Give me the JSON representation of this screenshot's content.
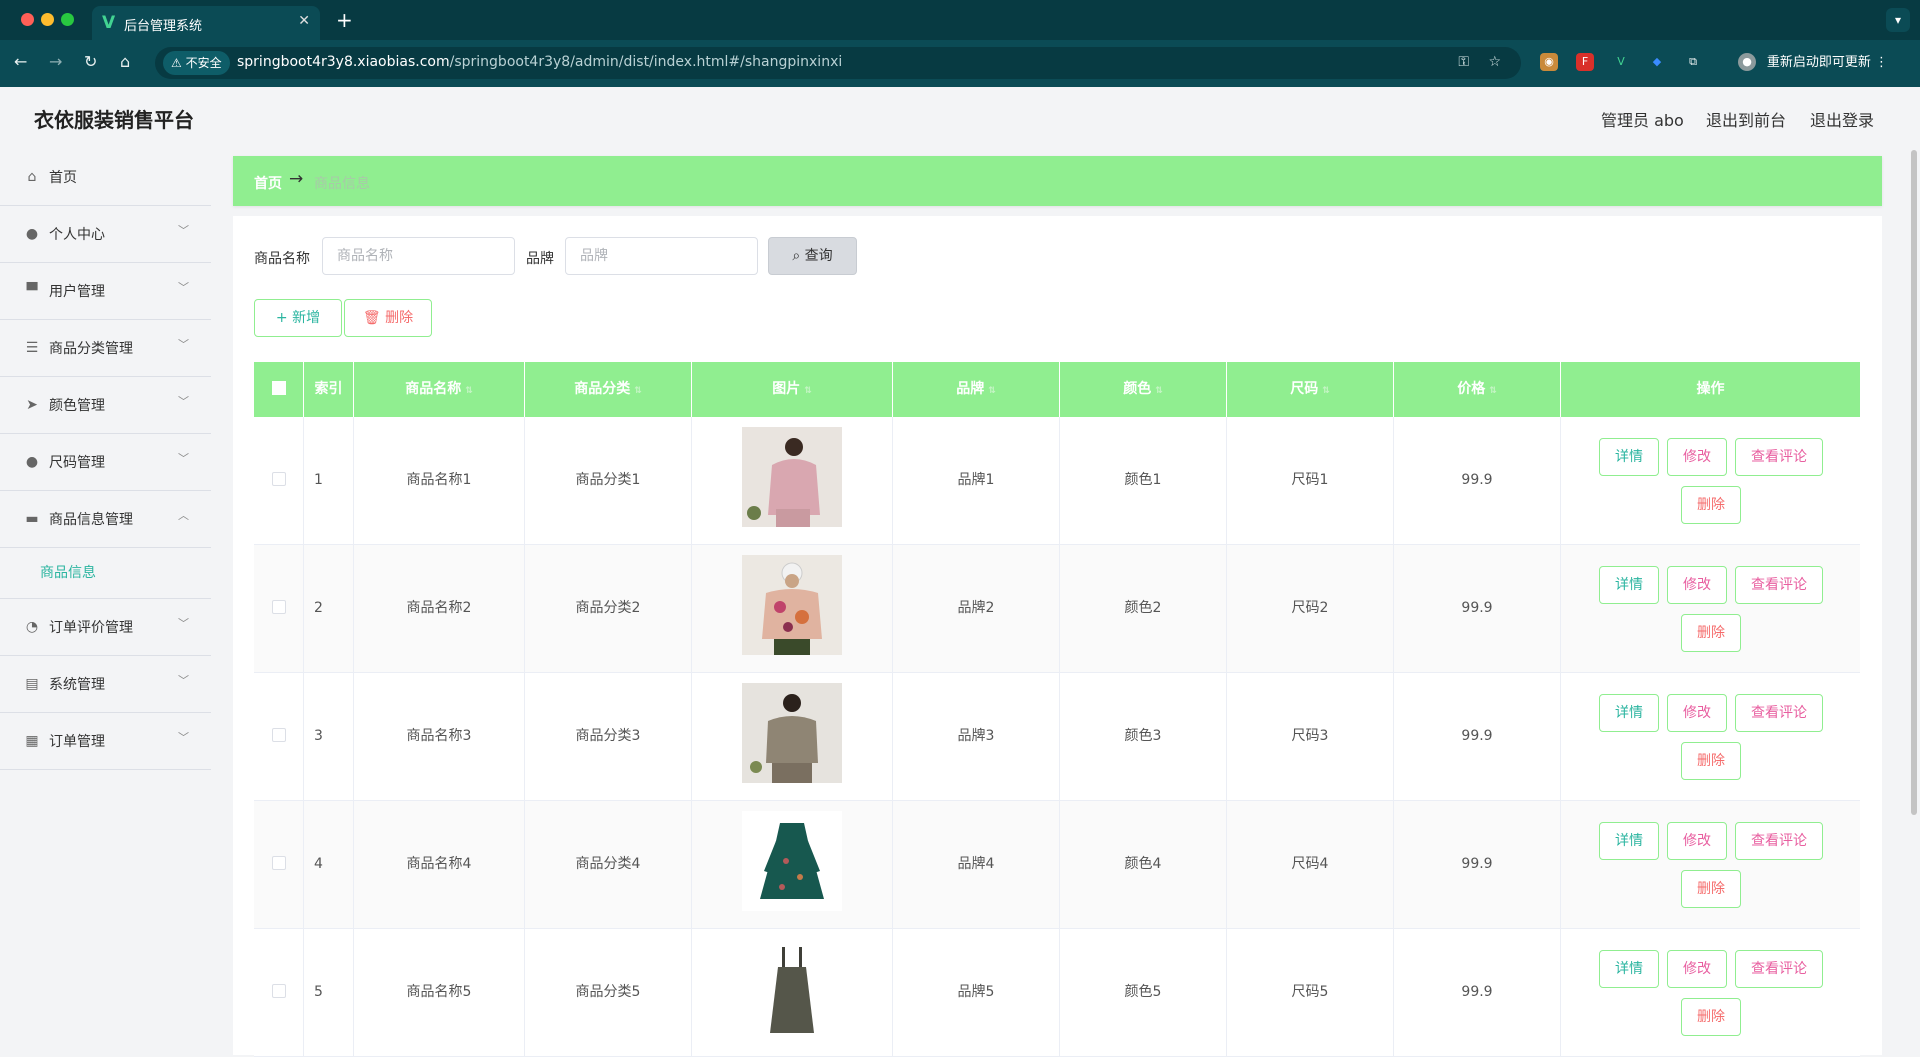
{
  "browser": {
    "tab_title": "后台管理系统",
    "favicon": "V",
    "secure_label": "不安全",
    "url_host": "springboot4r3y8.xiaobias.com",
    "url_path": "/springboot4r3y8/admin/dist/index.html#/shangpinxinxi",
    "update_label": "重新启动即可更新"
  },
  "header": {
    "brand": "衣依服装销售平台",
    "admin": "管理员 abo",
    "to_front": "退出到前台",
    "logout": "退出登录"
  },
  "sidebar": {
    "items": [
      {
        "label": "首页",
        "icon": "home-icon"
      },
      {
        "label": "个人中心",
        "icon": "user-icon"
      },
      {
        "label": "用户管理",
        "icon": "users-icon"
      },
      {
        "label": "商品分类管理",
        "icon": "list-icon"
      },
      {
        "label": "颜色管理",
        "icon": "send-icon"
      },
      {
        "label": "尺码管理",
        "icon": "user-icon"
      },
      {
        "label": "商品信息管理",
        "icon": "chat-icon"
      },
      {
        "label": "订单评价管理",
        "icon": "gauge-icon"
      },
      {
        "label": "系统管理",
        "icon": "clipboard-icon"
      },
      {
        "label": "订单管理",
        "icon": "grid-icon"
      }
    ],
    "sub_active": "商品信息"
  },
  "breadcrumb": {
    "home": "首页",
    "current": "商品信息"
  },
  "search": {
    "name_label": "商品名称",
    "name_placeholder": "商品名称",
    "brand_label": "品牌",
    "brand_placeholder": "品牌",
    "query_label": "查询"
  },
  "actions": {
    "add": "新增",
    "delete": "删除"
  },
  "table": {
    "headers": [
      "索引",
      "商品名称",
      "商品分类",
      "图片",
      "品牌",
      "颜色",
      "尺码",
      "价格",
      "操作"
    ],
    "rows": [
      {
        "index": "1",
        "name": "商品名称1",
        "category": "商品分类1",
        "brand": "品牌1",
        "color": "颜色1",
        "size": "尺码1",
        "price": "99.9"
      },
      {
        "index": "2",
        "name": "商品名称2",
        "category": "商品分类2",
        "brand": "品牌2",
        "color": "颜色2",
        "size": "尺码2",
        "price": "99.9"
      },
      {
        "index": "3",
        "name": "商品名称3",
        "category": "商品分类3",
        "brand": "品牌3",
        "color": "颜色3",
        "size": "尺码3",
        "price": "99.9"
      },
      {
        "index": "4",
        "name": "商品名称4",
        "category": "商品分类4",
        "brand": "品牌4",
        "color": "颜色4",
        "size": "尺码4",
        "price": "99.9"
      },
      {
        "index": "5",
        "name": "商品名称5",
        "category": "商品分类5",
        "brand": "品牌5",
        "color": "颜色5",
        "size": "尺码5",
        "price": "99.9"
      }
    ],
    "ops": {
      "detail": "详情",
      "edit": "修改",
      "review": "查看评论",
      "delete": "删除"
    }
  },
  "colors": {
    "accent_green": "#90ee90",
    "accent_teal": "#2bb5a0",
    "danger": "#f56c6c",
    "pink": "#e85fa0",
    "chrome_bg": "#0b4b55"
  }
}
